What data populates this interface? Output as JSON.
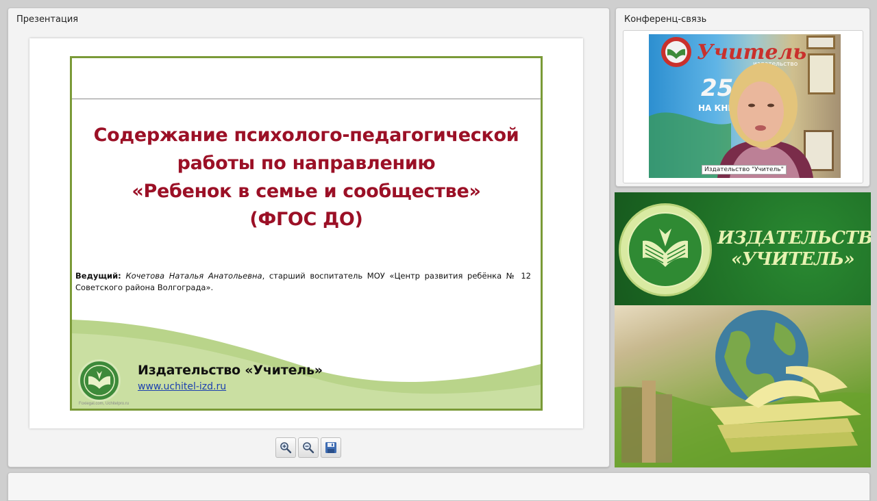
{
  "panels": {
    "presentation_title": "Презентация",
    "conference_title": "Конференц-связь"
  },
  "slide": {
    "title_lines": [
      "Содержание психолого-педагогической",
      "работы по направлению",
      "«Ребенок в семье и сообществе»",
      "(ФГОС ДО)"
    ],
    "presenter_label": "Ведущий:",
    "presenter_name": "Кочетова Наталья Анатольевна",
    "presenter_details": ", старший воспитатель МОУ «Центр развития ребёнка № 12 Советского района Волгограда».",
    "publisher": "Издательство «Учитель»",
    "url": "www.uchitel-izd.ru",
    "footnote": "Foxiegal.com, Uchitelpro.ru",
    "colors": {
      "title": "#9b1026",
      "border": "#7a9a37",
      "wave": "#b9d48a"
    }
  },
  "toolbar": {
    "buttons": [
      {
        "name": "zoom-in",
        "icon": "magnifier-plus-icon"
      },
      {
        "name": "zoom-out",
        "icon": "magnifier-minus-icon"
      },
      {
        "name": "save",
        "icon": "floppy-disk-icon"
      }
    ]
  },
  "webcam": {
    "participant_label": "Издательство \"Учитель\"",
    "background_sign": "Учитель",
    "background_sign_sub": "издательство",
    "background_number": "25",
    "background_caption": "НА КНИЖ"
  },
  "banner": {
    "line1": "ИЗДАТЕЛЬСТВО",
    "line2": "«УЧИТЕЛЬ»",
    "colors": {
      "green": "#1f6f26",
      "text": "#e7f2b2"
    }
  }
}
